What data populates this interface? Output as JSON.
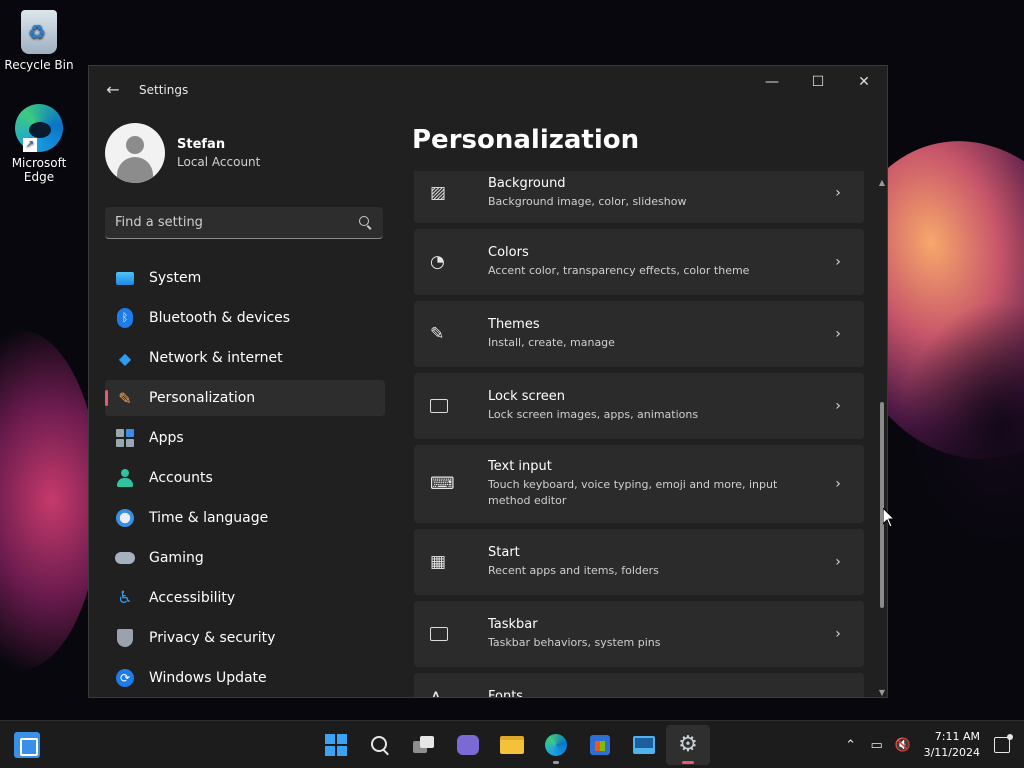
{
  "desktop": {
    "icons": [
      {
        "label": "Recycle Bin",
        "icon": "recycle-bin-icon"
      },
      {
        "label": "Microsoft Edge",
        "icon": "edge-icon"
      }
    ]
  },
  "window": {
    "title": "Settings",
    "controls": {
      "minimize": "—",
      "maximize": "☐",
      "close": "✕"
    }
  },
  "profile": {
    "name": "Stefan",
    "account_type": "Local Account"
  },
  "search": {
    "placeholder": "Find a setting"
  },
  "nav": {
    "items": [
      {
        "label": "System",
        "icon": "system-icon"
      },
      {
        "label": "Bluetooth & devices",
        "icon": "bluetooth-icon"
      },
      {
        "label": "Network & internet",
        "icon": "wifi-icon"
      },
      {
        "label": "Personalization",
        "icon": "brush-icon",
        "active": true
      },
      {
        "label": "Apps",
        "icon": "apps-icon"
      },
      {
        "label": "Accounts",
        "icon": "accounts-icon"
      },
      {
        "label": "Time & language",
        "icon": "time-language-icon"
      },
      {
        "label": "Gaming",
        "icon": "gaming-icon"
      },
      {
        "label": "Accessibility",
        "icon": "accessibility-icon"
      },
      {
        "label": "Privacy & security",
        "icon": "shield-icon"
      },
      {
        "label": "Windows Update",
        "icon": "update-icon"
      }
    ]
  },
  "main": {
    "title": "Personalization",
    "cards": [
      {
        "title": "Background",
        "subtitle": "Background image, color, slideshow",
        "icon": "background-image-icon"
      },
      {
        "title": "Colors",
        "subtitle": "Accent color, transparency effects, color theme",
        "icon": "palette-icon"
      },
      {
        "title": "Themes",
        "subtitle": "Install, create, manage",
        "icon": "themes-brush-icon"
      },
      {
        "title": "Lock screen",
        "subtitle": "Lock screen images, apps, animations",
        "icon": "lock-screen-icon"
      },
      {
        "title": "Text input",
        "subtitle": "Touch keyboard, voice typing, emoji and more, input method editor",
        "icon": "keyboard-icon"
      },
      {
        "title": "Start",
        "subtitle": "Recent apps and items, folders",
        "icon": "start-icon"
      },
      {
        "title": "Taskbar",
        "subtitle": "Taskbar behaviors, system pins",
        "icon": "taskbar-icon"
      },
      {
        "title": "Fonts",
        "subtitle": "",
        "icon": "fonts-icon"
      }
    ]
  },
  "taskbar": {
    "apps": [
      {
        "name": "start-button",
        "icon": "windows-logo-icon"
      },
      {
        "name": "search-button",
        "icon": "search-icon"
      },
      {
        "name": "task-view-button",
        "icon": "task-view-icon"
      },
      {
        "name": "chat-button",
        "icon": "chat-icon"
      },
      {
        "name": "file-explorer-button",
        "icon": "folder-icon"
      },
      {
        "name": "edge-button",
        "icon": "edge-icon"
      },
      {
        "name": "store-button",
        "icon": "store-icon"
      },
      {
        "name": "remote-desktop-button",
        "icon": "remote-desktop-icon"
      },
      {
        "name": "settings-button",
        "icon": "gear-icon",
        "active": true
      }
    ],
    "time": "7:11 AM",
    "date": "3/11/2024"
  },
  "colors": {
    "accent": "#e85a70",
    "window_bg": "#202020",
    "card_bg": "#2b2b2b"
  }
}
